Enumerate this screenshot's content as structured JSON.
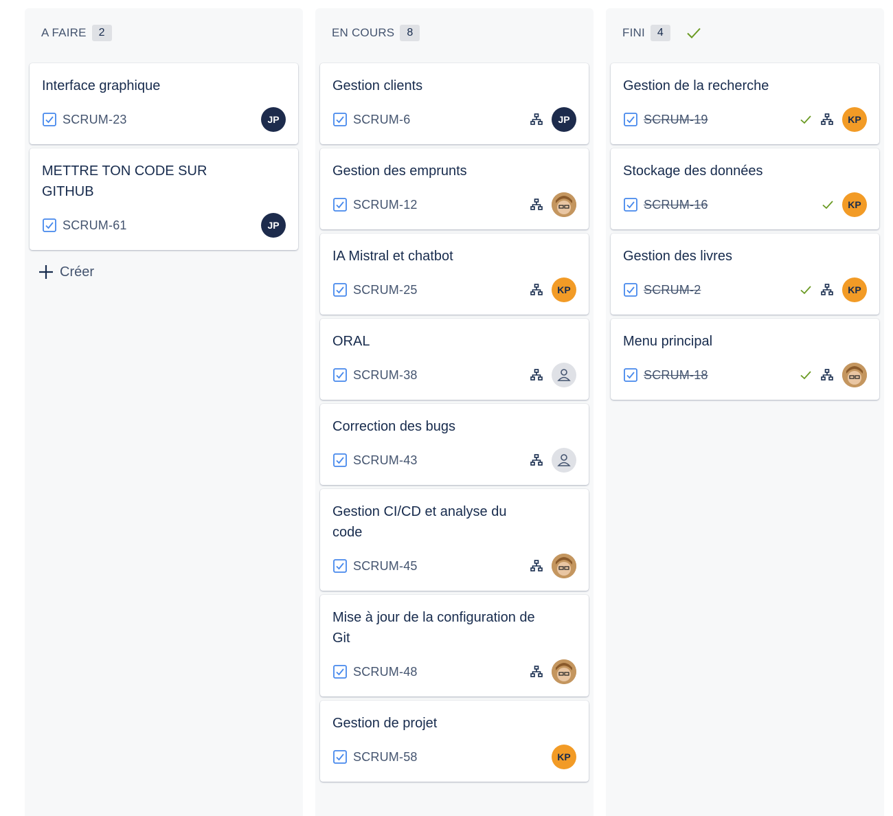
{
  "colors": {
    "column_bg": "#f7f8f9",
    "story_icon": "#4688ec",
    "done_check": "#6a9a23",
    "avatar_jp": "#1d2b4c",
    "avatar_kp": "#f29b26"
  },
  "columns": [
    {
      "title": "A FAIRE",
      "count": "2",
      "cards": [
        {
          "title": "Interface graphique",
          "key": "SCRUM-23"
        },
        {
          "title": "METTRE TON CODE SUR GITHUB",
          "key": "SCRUM-61"
        }
      ],
      "create_label": "Créer"
    },
    {
      "title": "EN COURS",
      "count": "8",
      "cards": [
        {
          "title": "Gestion clients",
          "key": "SCRUM-6"
        },
        {
          "title": "Gestion des emprunts",
          "key": "SCRUM-12"
        },
        {
          "title": "IA Mistral et chatbot",
          "key": "SCRUM-25"
        },
        {
          "title": "ORAL",
          "key": "SCRUM-38"
        },
        {
          "title": "Correction des bugs",
          "key": "SCRUM-43"
        },
        {
          "title": "Gestion CI/CD et analyse du code",
          "key": "SCRUM-45"
        },
        {
          "title": "Mise à jour de la configuration de Git",
          "key": "SCRUM-48"
        },
        {
          "title": "Gestion de projet",
          "key": "SCRUM-58"
        }
      ]
    },
    {
      "title": "FINI",
      "count": "4",
      "cards": [
        {
          "title": "Gestion de la recherche",
          "key": "SCRUM-19"
        },
        {
          "title": "Stockage des données",
          "key": "SCRUM-16"
        },
        {
          "title": "Gestion des livres",
          "key": "SCRUM-2"
        },
        {
          "title": "Menu principal",
          "key": "SCRUM-18"
        }
      ]
    }
  ],
  "avatars": {
    "jp": "JP",
    "kp": "KP"
  }
}
